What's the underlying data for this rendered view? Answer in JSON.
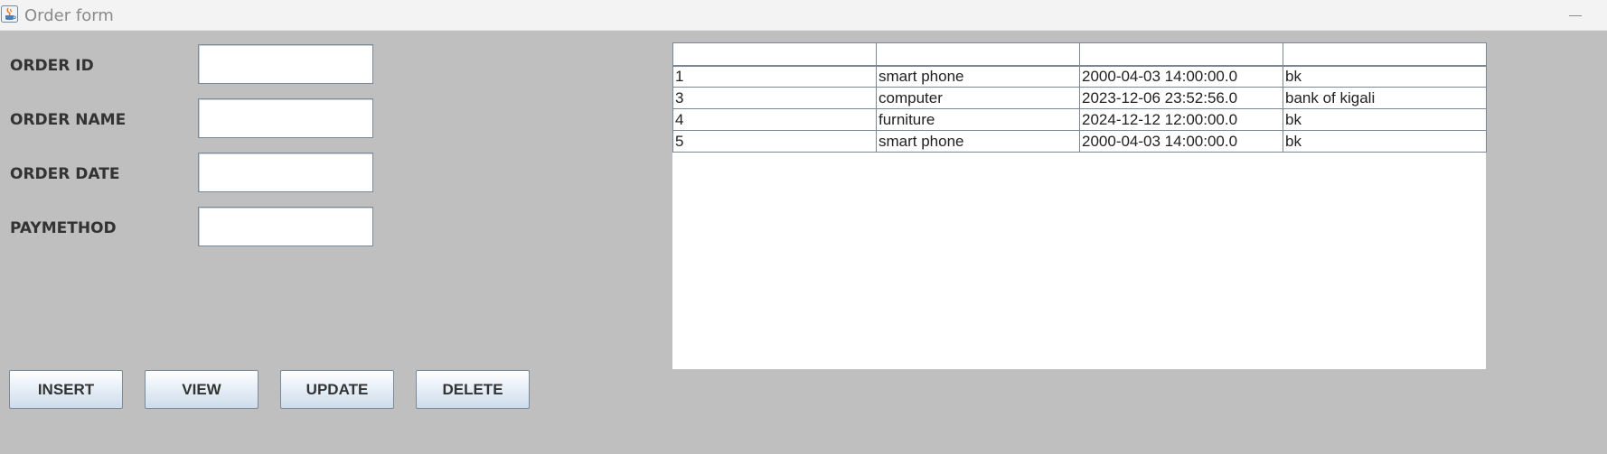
{
  "window": {
    "title": "Order form",
    "icon": "java-icon"
  },
  "form": {
    "fields": [
      {
        "label": "ORDER ID",
        "value": ""
      },
      {
        "label": "ORDER NAME",
        "value": ""
      },
      {
        "label": "ORDER DATE",
        "value": ""
      },
      {
        "label": "PAYMETHOD",
        "value": ""
      }
    ]
  },
  "buttons": {
    "insert": "INSERT",
    "view": "VIEW",
    "update": "UPDATE",
    "delete": "DELETE"
  },
  "table": {
    "headers": [
      "",
      "",
      "",
      ""
    ],
    "rows": [
      [
        "1",
        "smart phone",
        "2000-04-03 14:00:00.0",
        "bk"
      ],
      [
        "3",
        "computer",
        "2023-12-06 23:52:56.0",
        "bank of kigali"
      ],
      [
        "4",
        "furniture",
        "2024-12-12 12:00:00.0",
        "bk"
      ],
      [
        "5",
        "smart phone",
        "2000-04-03 14:00:00.0",
        "bk"
      ]
    ]
  }
}
